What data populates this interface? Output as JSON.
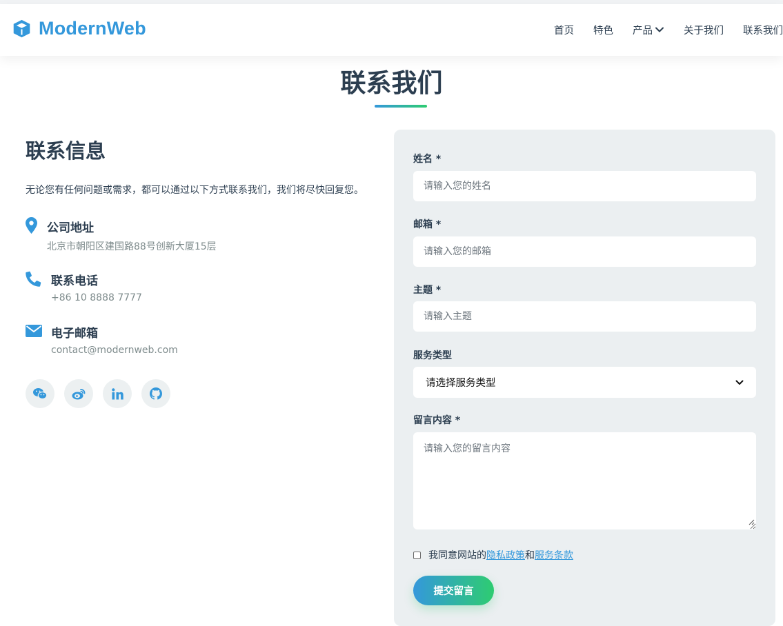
{
  "brand": {
    "name": "ModernWeb",
    "icon": "cube-icon",
    "color": "#3498db"
  },
  "nav": {
    "items": [
      {
        "label": "首页"
      },
      {
        "label": "特色"
      },
      {
        "label": "产品",
        "has_dropdown": true
      },
      {
        "label": "关于我们"
      },
      {
        "label": "联系我们"
      }
    ]
  },
  "section": {
    "title": "联系我们"
  },
  "contact_info": {
    "title": "联系信息",
    "description": "无论您有任何问题或需求，都可以通过以下方式联系我们，我们将尽快回复您。",
    "items": [
      {
        "icon": "map-marker-icon",
        "label": "公司地址",
        "value": "北京市朝阳区建国路88号创新大厦15层"
      },
      {
        "icon": "phone-icon",
        "label": "联系电话",
        "value": "+86 10 8888 7777"
      },
      {
        "icon": "envelope-icon",
        "label": "电子邮箱",
        "value": "contact@modernweb.com"
      }
    ],
    "socials": [
      "wechat-icon",
      "weibo-icon",
      "linkedin-icon",
      "github-icon"
    ]
  },
  "form": {
    "name": {
      "label": "姓名 *",
      "placeholder": "请输入您的姓名"
    },
    "email": {
      "label": "邮箱 *",
      "placeholder": "请输入您的邮箱"
    },
    "subject": {
      "label": "主题 *",
      "placeholder": "请输入主题"
    },
    "service": {
      "label": "服务类型",
      "selected": "请选择服务类型"
    },
    "message": {
      "label": "留言内容 *",
      "placeholder": "请输入您的留言内容"
    },
    "agree": {
      "prefix": "我同意网站的",
      "privacy": "隐私政策",
      "and": "和",
      "terms": "服务条款",
      "checked": false
    },
    "submit_label": "提交留言"
  },
  "colors": {
    "accent": "#3498db",
    "accent_end": "#2ecc71",
    "text": "#2c3e50",
    "muted": "#7f8c8d",
    "card_bg": "#ebeff1"
  }
}
